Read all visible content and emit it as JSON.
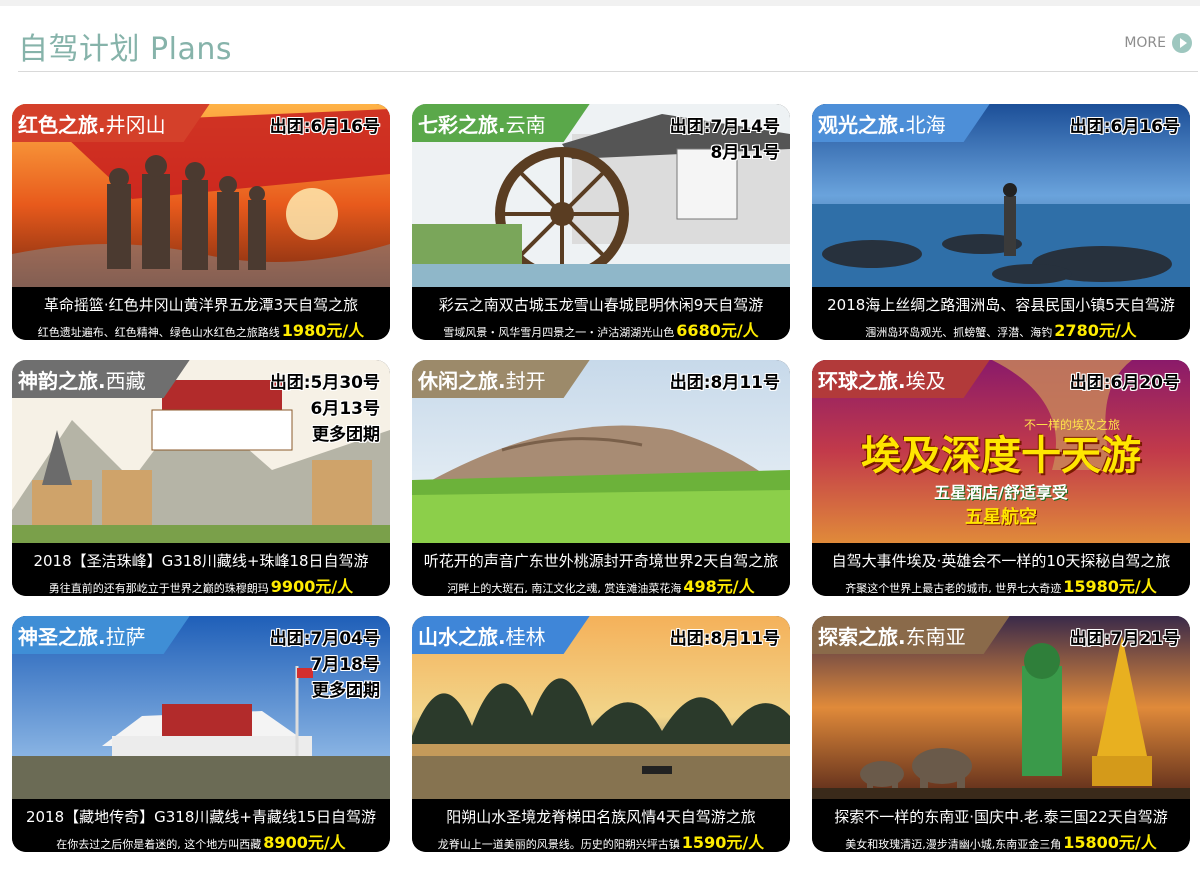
{
  "header": {
    "title": "自驾计划 Plans",
    "more": "MORE",
    "more_icon": "play-circle-icon"
  },
  "cards": [
    {
      "tag_theme": "红色之旅.",
      "tag_city": "井冈山",
      "tag_color": "#d4402a",
      "dates": [
        "出团:6月16号"
      ],
      "title": "革命摇篮·红色井冈山黄洋界五龙潭3天自驾之旅",
      "desc": "红色遗址遍布、红色精神、绿色山水红色之旅路线",
      "price": "1980元/人"
    },
    {
      "tag_theme": "七彩之旅.",
      "tag_city": "云南",
      "tag_color": "#5aa84a",
      "dates": [
        "出团:7月14号",
        "8月11号"
      ],
      "title": "彩云之南双古城玉龙雪山春城昆明休闲9天自驾游",
      "desc": "雪域风景・风华雪月四景之一・泸沽湖湖光山色",
      "price": "6680元/人"
    },
    {
      "tag_theme": "观光之旅.",
      "tag_city": "北海",
      "tag_color": "#4d8fd8",
      "dates": [
        "出团:6月16号"
      ],
      "title": "2018海上丝绸之路涠洲岛、容县民国小镇5天自驾游",
      "desc": "涠洲岛环岛观光、抓螃蟹、浮潜、海钓",
      "price": "2780元/人"
    },
    {
      "tag_theme": "神韵之旅.",
      "tag_city": "西藏",
      "tag_color": "#6f6f6f",
      "dates": [
        "出团:5月30号",
        "6月13号",
        "更多团期"
      ],
      "title": "2018【圣洁珠峰】G318川藏线+珠峰18日自驾游",
      "desc": "勇往直前的还有那屹立于世界之巅的珠穆朗玛",
      "price": "9900元/人"
    },
    {
      "tag_theme": "休闲之旅.",
      "tag_city": "封开",
      "tag_color": "#9c8a6a",
      "dates": [
        "出团:8月11号"
      ],
      "title": "听花开的声音广东世外桃源封开奇境世界2天自驾之旅",
      "desc": "河畔上的大斑石, 南江文化之魂, 赏连滩油菜花海",
      "price": "498元/人"
    },
    {
      "tag_theme": "环球之旅.",
      "tag_city": "埃及",
      "tag_color": "#b23a3a",
      "dates": [
        "出团:6月20号"
      ],
      "title": "自驾大事件埃及·英雄会不一样的10天探秘自驾之旅",
      "desc": "齐聚这个世界上最古老的城市, 世界七大奇迹",
      "price": "15980元/人",
      "banner": "埃及深度十天游",
      "banner_sub": "不一样的埃及之旅",
      "banner_line2": "五星酒店/舒适享受",
      "banner_line3": "五星航空"
    },
    {
      "tag_theme": "神圣之旅.",
      "tag_city": "拉萨",
      "tag_color": "#3f8ed6",
      "dates": [
        "出团:7月04号",
        "7月18号",
        "更多团期"
      ],
      "title": "2018【藏地传奇】G318川藏线+青藏线15日自驾游",
      "desc": "在你去过之后你是着迷的, 这个地方叫西藏",
      "price": "8900元/人"
    },
    {
      "tag_theme": "山水之旅.",
      "tag_city": "桂林",
      "tag_color": "#3f86d8",
      "dates": [
        "出团:8月11号"
      ],
      "title": "阳朔山水圣境龙脊梯田名族风情4天自驾游之旅",
      "desc": "龙脊山上一道美丽的风景线。历史的阳朔兴坪古镇",
      "price": "1590元/人"
    },
    {
      "tag_theme": "探索之旅.",
      "tag_city": "东南亚",
      "tag_color": "#8a6a4a",
      "dates": [
        "出团:7月21号"
      ],
      "title": "探索不一样的东南亚·国庆中.老.泰三国22天自驾游",
      "desc": "美女和玫瑰清迈,漫步清幽小城,东南亚金三角",
      "price": "15800元/人"
    }
  ]
}
